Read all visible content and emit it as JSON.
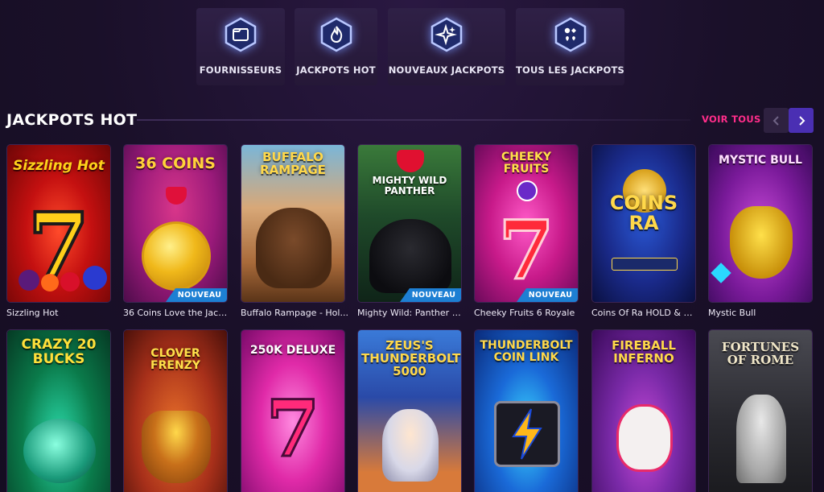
{
  "categories": [
    {
      "label": "FOURNISSEURS",
      "icon": "folder-icon"
    },
    {
      "label": "JACKPOTS HOT",
      "icon": "flame-icon"
    },
    {
      "label": "NOUVEAUX JACKPOTS",
      "icon": "sparkle-icon"
    },
    {
      "label": "TOUS LES JACKPOTS",
      "icon": "card-suits-icon"
    }
  ],
  "section": {
    "title": "JACKPOTS HOT",
    "see_all": "VOIR TOUS"
  },
  "games_row1": [
    {
      "name": "Sizzling Hot",
      "logo": "Sizzling Hot",
      "badge": ""
    },
    {
      "name": "36 Coins Love the Jack...",
      "logo": "36 COINS",
      "badge": "NOUVEAU"
    },
    {
      "name": "Buffalo Rampage - Hol...",
      "logo": "BUFFALO RAMPAGE",
      "badge": ""
    },
    {
      "name": "Mighty Wild: Panther G...",
      "logo": "MIGHTY WILD PANTHER",
      "badge": "NOUVEAU"
    },
    {
      "name": "Cheeky Fruits 6 Royale",
      "logo": "CHEEKY FRUITS",
      "badge": "NOUVEAU"
    },
    {
      "name": "Coins Of Ra HOLD & WIN",
      "logo": "COINS RA",
      "badge": ""
    },
    {
      "name": "Mystic Bull",
      "logo": "MYSTIC BULL",
      "badge": ""
    }
  ],
  "games_row2": [
    {
      "logo": "CRAZY 20 BUCKS"
    },
    {
      "logo": "CLOVER FRENZY"
    },
    {
      "logo": "250K DELUXE"
    },
    {
      "logo": "ZEUS'S THUNDERBOLT 5000"
    },
    {
      "logo": "THUNDERBOLT COIN LINK"
    },
    {
      "logo": "FIREBALL INFERNO"
    },
    {
      "logo": "FORTUNES OF ROME"
    }
  ],
  "colors": {
    "background": "#1a1029",
    "accent_pink": "#ff2d8a",
    "nav_active": "#4a2fb3",
    "badge_blue": "#1d7fd3",
    "icon_glow": "#7a96ff"
  }
}
